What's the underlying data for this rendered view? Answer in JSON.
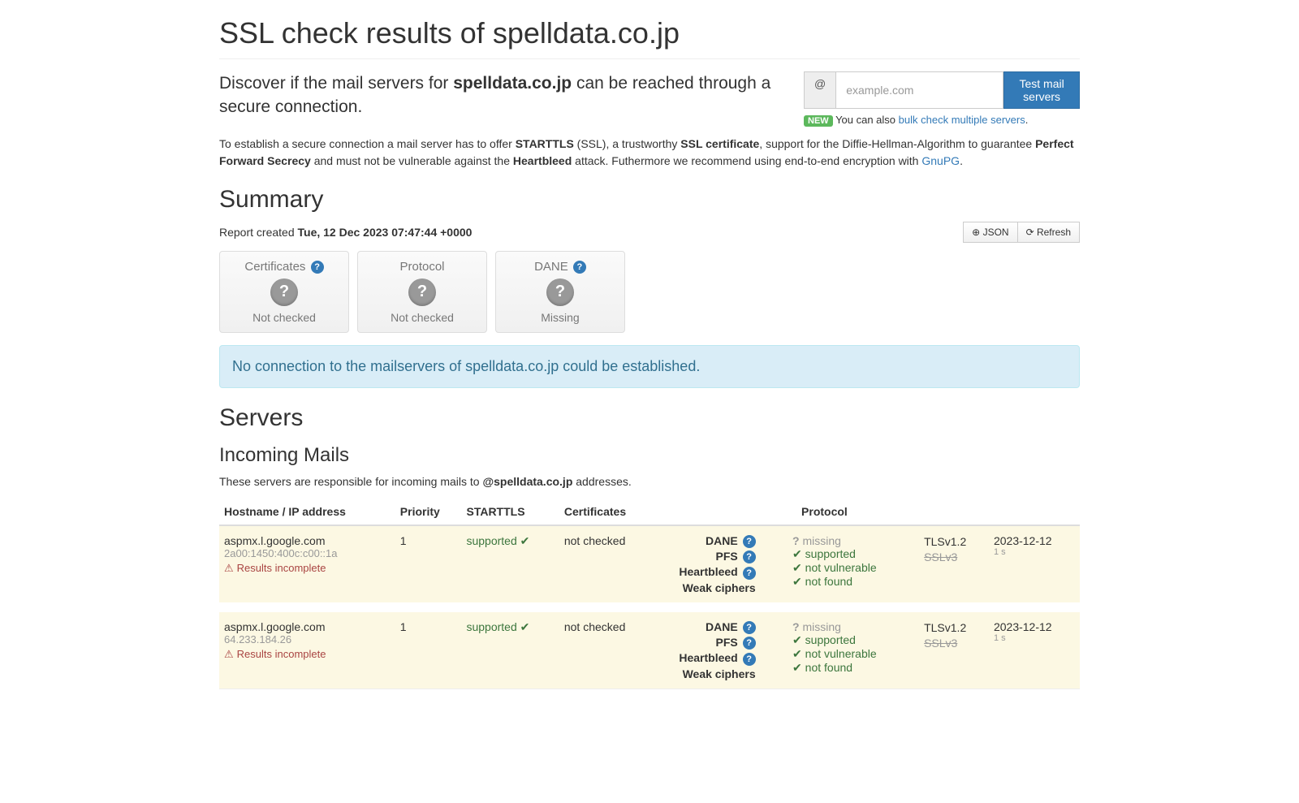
{
  "title_prefix": "SSL check results of ",
  "title_domain": "spelldata.co.jp",
  "lead_pre": "Discover if the mail servers for ",
  "lead_domain": "spelldata.co.jp",
  "lead_post": " can be reached through a secure connection.",
  "search": {
    "addon": "@",
    "placeholder": "example.com",
    "button": "Test mail servers",
    "new_badge": "NEW",
    "also_pre": "You can also ",
    "also_link": "bulk check multiple servers",
    "also_post": "."
  },
  "intro": {
    "p1a": "To establish a secure connection a mail server has to offer ",
    "p1b": "STARTTLS",
    "p1c": " (SSL), a trustworthy ",
    "p1d": "SSL certificate",
    "p1e": ", support for the Diffie-Hellman-Algorithm to guarantee ",
    "p1f": "Perfect Forward Secrecy",
    "p1g": " and must not be vulnerable against the ",
    "p1h": "Heartbleed",
    "p1i": " attack. Futhermore we recommend using end-to-end encryption with ",
    "p1j": "GnuPG",
    "p1k": "."
  },
  "summary": {
    "heading": "Summary",
    "report_pre": "Report created ",
    "report_date": "Tue, 12 Dec 2023 07:47:44 +0000",
    "json_btn": "JSON",
    "refresh_btn": "Refresh",
    "cards": [
      {
        "title": "Certificates",
        "help": true,
        "status": "Not checked"
      },
      {
        "title": "Protocol",
        "help": false,
        "status": "Not checked"
      },
      {
        "title": "DANE",
        "help": true,
        "status": "Missing"
      }
    ],
    "alert": "No connection to the mailservers of spelldata.co.jp could be established."
  },
  "servers": {
    "heading": "Servers",
    "incoming_heading": "Incoming Mails",
    "incoming_desc_pre": "These servers are responsible for incoming mails to ",
    "incoming_desc_domain": "@spelldata.co.jp",
    "incoming_desc_post": " addresses.",
    "cols": {
      "host": "Hostname / IP address",
      "prio": "Priority",
      "starttls": "STARTTLS",
      "certs": "Certificates",
      "proto": "Protocol"
    },
    "rows": [
      {
        "host": "aspmx.l.google.com",
        "ip": "2a00:1450:400c:c00::1a",
        "warn": "Results incomplete",
        "prio": "1",
        "starttls": "supported",
        "certs": "not checked",
        "proto": {
          "dane_label": "DANE",
          "dane_val": "missing",
          "pfs_label": "PFS",
          "pfs_val": "supported",
          "hb_label": "Heartbleed",
          "hb_val": "not vulnerable",
          "wc_label": "Weak ciphers",
          "wc_val": "not found"
        },
        "tls1": "TLSv1.2",
        "tls2": "SSLv3",
        "date": "2023-12-12",
        "dur": "1 s"
      },
      {
        "host": "aspmx.l.google.com",
        "ip": "64.233.184.26",
        "warn": "Results incomplete",
        "prio": "1",
        "starttls": "supported",
        "certs": "not checked",
        "proto": {
          "dane_label": "DANE",
          "dane_val": "missing",
          "pfs_label": "PFS",
          "pfs_val": "supported",
          "hb_label": "Heartbleed",
          "hb_val": "not vulnerable",
          "wc_label": "Weak ciphers",
          "wc_val": "not found"
        },
        "tls1": "TLSv1.2",
        "tls2": "SSLv3",
        "date": "2023-12-12",
        "dur": "1 s"
      }
    ]
  }
}
